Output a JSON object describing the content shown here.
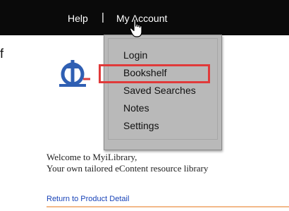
{
  "nav": {
    "help_label": "Help",
    "separator": "|",
    "account_label": "My Account"
  },
  "dropdown": {
    "items": [
      {
        "label": "Login"
      },
      {
        "label": "Bookshelf",
        "highlighted": true
      },
      {
        "label": "Saved Searches"
      },
      {
        "label": "Notes"
      },
      {
        "label": "Settings"
      }
    ]
  },
  "edge_text": "f",
  "welcome": {
    "line1": "Welcome to MyiLibrary,",
    "line2": "Your own tailored eContent resource library"
  },
  "return_link": "Return to Product Detail",
  "colors": {
    "topbar": "#0a0a0a",
    "dropdown_bg": "#b9b9b9",
    "highlight_border": "#e03a3a",
    "link": "#1a44b8",
    "logo_blue": "#2f5fb3"
  },
  "icons": [
    "hand-pointer-cursor-icon",
    "myilibrary-logo"
  ]
}
